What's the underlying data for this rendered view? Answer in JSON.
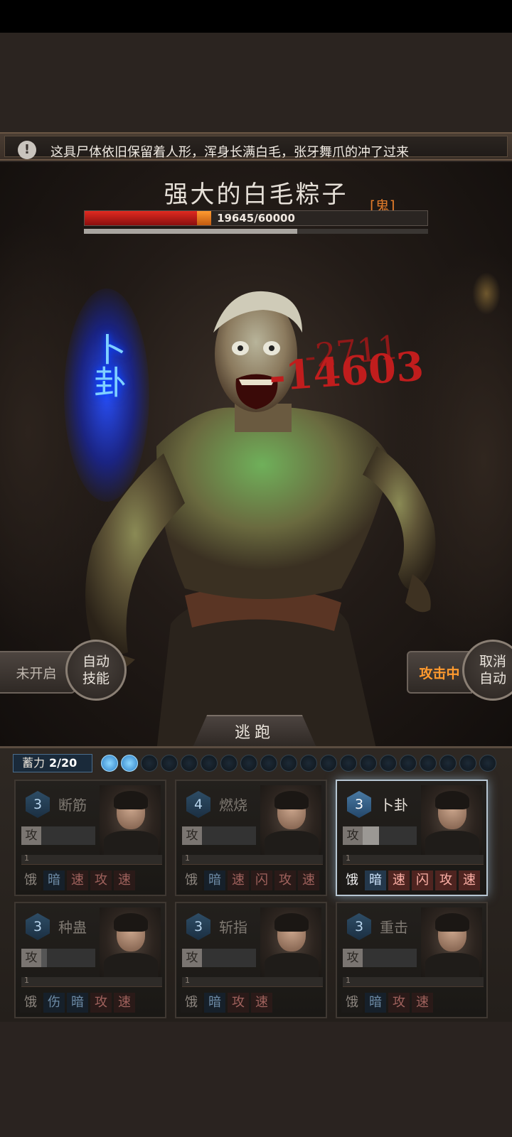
{
  "message": {
    "icon": "alert-icon",
    "icon_glyph": "!",
    "text": "这具尸体依旧保留着人形，浑身长满白毛，张牙舞爪的冲了过来"
  },
  "boss": {
    "name": "强大的白毛粽子",
    "type_tag": "[鬼]",
    "hp_text": "19645/60000",
    "hp_current": 19645,
    "hp_max": 60000,
    "hp_recent_damage_fraction": 0.04,
    "secondary_bar_fraction": 0.62
  },
  "scene": {
    "skill_effect_text": "卜卦",
    "damage_numbers": [
      "-2711",
      "-14603"
    ]
  },
  "controls": {
    "left_status": "未开启",
    "auto_skill": "自动\n技能",
    "right_status": "攻击中",
    "cancel_auto": "取消\n自动",
    "escape": "逃跑"
  },
  "charge": {
    "label": "蓄力",
    "value": "2/20",
    "filled": 2,
    "total": 20
  },
  "cards": [
    {
      "level": "3",
      "name": "断筋",
      "atk": "攻",
      "atk_fill": 0.0,
      "prog": "1",
      "tags": [
        "饿",
        "暗",
        "速",
        "攻",
        "速"
      ],
      "tag_styles": [
        "",
        "blue",
        "red",
        "red",
        "red"
      ],
      "active": false
    },
    {
      "level": "4",
      "name": "燃烧",
      "atk": "攻",
      "atk_fill": 0.0,
      "prog": "1",
      "tags": [
        "饿",
        "暗",
        "速",
        "闪",
        "攻",
        "速"
      ],
      "tag_styles": [
        "",
        "blue",
        "red",
        "red",
        "red",
        "red"
      ],
      "active": false
    },
    {
      "level": "3",
      "name": "卜卦",
      "atk": "攻",
      "atk_fill": 0.3,
      "prog": "1",
      "tags": [
        "饿",
        "暗",
        "速",
        "闪",
        "攻",
        "速"
      ],
      "tag_styles": [
        "",
        "blue",
        "red",
        "red",
        "red",
        "red"
      ],
      "active": true
    },
    {
      "level": "3",
      "name": "种蛊",
      "atk": "攻",
      "atk_fill": 0.1,
      "prog": "1",
      "tags": [
        "饿",
        "伤",
        "暗",
        "攻",
        "速"
      ],
      "tag_styles": [
        "",
        "blue",
        "blue",
        "red",
        "red"
      ],
      "active": false
    },
    {
      "level": "3",
      "name": "斩指",
      "atk": "攻",
      "atk_fill": 0.0,
      "prog": "1",
      "tags": [
        "饿",
        "暗",
        "攻",
        "速"
      ],
      "tag_styles": [
        "",
        "blue",
        "red",
        "red"
      ],
      "active": false
    },
    {
      "level": "3",
      "name": "重击",
      "atk": "攻",
      "atk_fill": 0.0,
      "prog": "1",
      "tags": [
        "饿",
        "暗",
        "攻",
        "速"
      ],
      "tag_styles": [
        "",
        "blue",
        "red",
        "red"
      ],
      "active": false
    }
  ]
}
